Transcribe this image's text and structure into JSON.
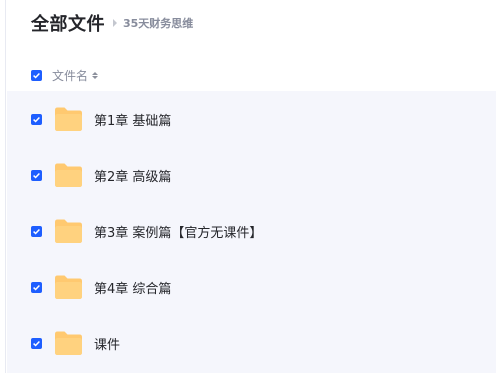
{
  "header": {
    "title": "全部文件",
    "breadcrumb": "35天财务思维"
  },
  "column_header": {
    "label": "文件名"
  },
  "files": [
    {
      "name": "第1章 基础篇",
      "checked": true,
      "type": "folder"
    },
    {
      "name": "第2章 高级篇",
      "checked": true,
      "type": "folder"
    },
    {
      "name": "第3章 案例篇【官方无课件】",
      "checked": true,
      "type": "folder"
    },
    {
      "name": "第4章 综合篇",
      "checked": true,
      "type": "folder"
    },
    {
      "name": "课件",
      "checked": true,
      "type": "folder"
    }
  ],
  "colors": {
    "checkbox": "#1e5eff",
    "folder": "#ffc970",
    "list_background": "#f5f6fc",
    "title_text": "#25262b",
    "muted_text": "#878c9c"
  }
}
